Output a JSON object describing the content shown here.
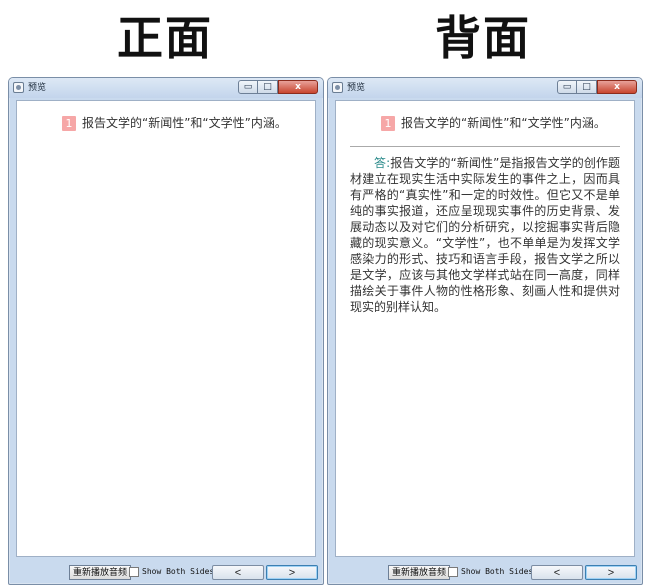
{
  "headings": {
    "front": "正面",
    "back": "背面"
  },
  "window": {
    "title": "预览",
    "controls": {
      "minimize": "▭",
      "maximize": "□",
      "close": "x"
    }
  },
  "card": {
    "question_number": "1",
    "question": "报告文学的“新闻性”和“文学性”内涵。",
    "answer_label": "答:",
    "answer_text": "报告文学的“新闻性”是指报告文学的创作题材建立在现实生活中实际发生的事件之上，因而具有严格的“真实性”和一定的时效性。但它又不是单纯的事实报道，还应呈现现实事件的历史背景、发展动态以及对它们的分析研究，以挖掘事实背后隐藏的现实意义。“文学性”，也不单单是为发挥文学感染力的形式、技巧和语言手段，报告文学之所以是文学，应该与其他文学样式站在同一高度，同样描绘关于事件人物的性格形象、刻画人性和提供对现实的别样认知。"
  },
  "footer": {
    "replay_button": "重新播放音频",
    "show_both_sides_label": "Show Both Sides",
    "prev_button": "<",
    "next_button": ">"
  }
}
